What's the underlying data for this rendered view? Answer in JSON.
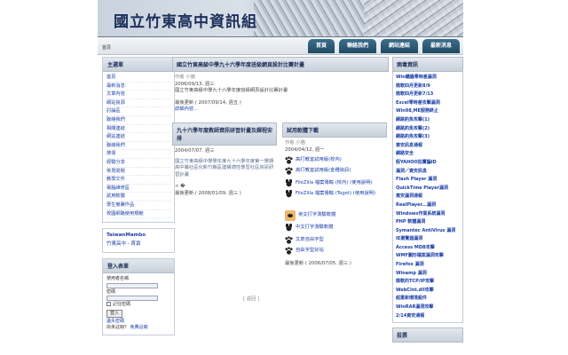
{
  "banner": {
    "title": "國立竹東高中資訊組"
  },
  "breadcrumb": "首頁",
  "tabs": [
    "首頁",
    "聯絡我們",
    "網站連結",
    "最新消息"
  ],
  "main_menu": {
    "title": "主選單",
    "items": [
      "首頁",
      "最新消息",
      "文章內容",
      "網站資源",
      "討論區",
      "聯絡我們",
      "相關連結",
      "網站連結",
      "聯絡我們",
      "搜尋",
      "經驗分享",
      "常見問題",
      "教學文件",
      "電腦維修區",
      "試用軟體",
      "學生競賽作品",
      "校園網路使用規範"
    ]
  },
  "extra_links": [
    "TaiwanMambo",
    "竹東高中 - 首頁"
  ],
  "login": {
    "title": "登入表單",
    "user_label": "使用者名稱",
    "pass_label": "密碼",
    "remember_label": "記住密碼",
    "login_button": "登入",
    "forgot_link": "遺失密碼",
    "no_account": "尚未註冊？",
    "register_link": "免費註冊"
  },
  "article1": {
    "title": "國立竹東高級中學九十六學年度班級網頁設計比賽計畫",
    "author": "作者 小猫",
    "date": "2006/09/13, 週三",
    "body": "國立竹東高級中學九十六學年度班級網頁設計比賽計畫",
    "updated": "最後更新 ( 2007/09/14, 週五 )",
    "readmore": "詳細內容..."
  },
  "article2": {
    "title": "九十六學年度教師資訊研習計畫及課程安排",
    "date": "2004/07/07, 週三",
    "body": "國立竹東高級中學學年度九十六學年度第一學期高中職社區化新竹縣區建構適性學習社區資訊研習計畫",
    "updated": "最後更新 ( 2008/01/09, 週三 )",
    "stray": "< �"
  },
  "article3": {
    "title": "試用軟體下載",
    "author": "作者 小猫",
    "date": "2004/04/12, 週一",
    "items": [
      "高打教室試用版(校內)",
      "高打教室試用版(金種資訊)",
      "FileZilla 檔案傳輸 (校內) (使用說明)",
      "FileZilla 檔案傳輸 (Toget) (使用說明)",
      "英文打字測驗軟體",
      "中文打字測驗軟體",
      "文泉自由字型",
      "自由字型好站"
    ],
    "updated": "最後更新 ( 2006/07/05, 週三 )"
  },
  "stray_link": "[ 返回 ]",
  "news": {
    "title": "病毒資訊",
    "items": [
      "Win蠕蟲零時差漏洞",
      "微軟四月更新8/9",
      "微軟四月更新7/13",
      "Excel零時差攻擊漏洞",
      "Win98,ME服務終止",
      "網路釣魚攻擊(1)",
      "網路釣魚攻擊(2)",
      "網路釣魚攻擊(3)",
      "資安訊息通報",
      "網路安全",
      "假YAHOO拍賣騙ID",
      "漏洞／資安訊息",
      "Flash Player 漏洞",
      "QuickTime Player漏洞",
      "資安漏洞通報",
      "RealPlayer...漏洞",
      "Windows作業系統漏洞",
      "PHP 軟體漏洞",
      "Symantec AntiVirus 漏洞",
      "IE瀏覽器漏洞",
      "Access MDB攻擊",
      "WMF圖形檔案漏洞攻擊",
      "Firefox 漏洞",
      "Winamp 漏洞",
      "微軟的TCP/IP攻擊",
      "WebCInt.dll攻擊",
      "超重新環境組件",
      "WinRAR漏洞攻擊",
      "2/14資安通報"
    ]
  },
  "vote": {
    "title": "投票"
  }
}
